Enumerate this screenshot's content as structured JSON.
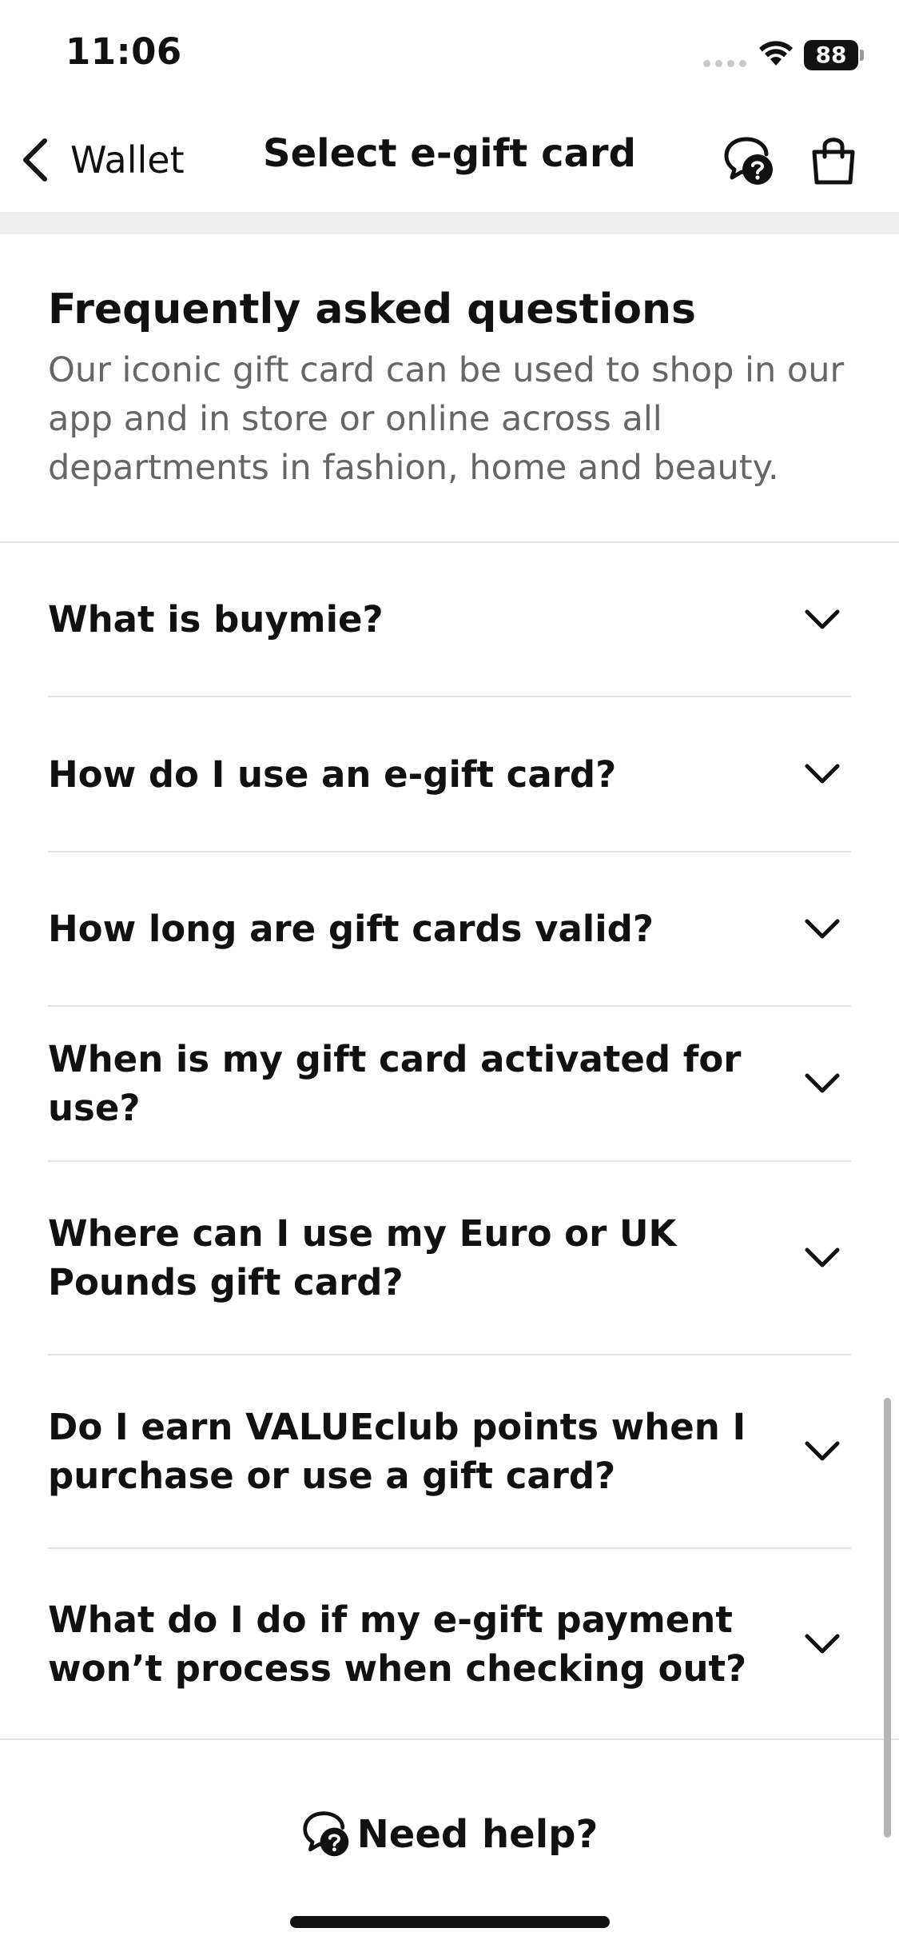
{
  "status_bar": {
    "time": "11:06",
    "battery_level": "88"
  },
  "nav": {
    "back_label": "Wallet",
    "title": "Select e-gift card"
  },
  "faq": {
    "title": "Frequently asked questions",
    "intro": "Our iconic gift card can be used to shop in our app and in store or online across all departments in fashion, home and beauty.",
    "items": [
      {
        "question": "What is buymie?"
      },
      {
        "question": "How do I use an e-gift card?"
      },
      {
        "question": "How long are gift cards valid?"
      },
      {
        "question": "When is my gift card activated for use?"
      },
      {
        "question": "Where can I use my Euro or UK Pounds gift card?"
      },
      {
        "question": "Do I earn VALUEclub points when I purchase or use a gift card?"
      },
      {
        "question": "What do I do if my e-gift payment won’t process when checking out?"
      }
    ]
  },
  "help": {
    "label": "Need help?"
  }
}
